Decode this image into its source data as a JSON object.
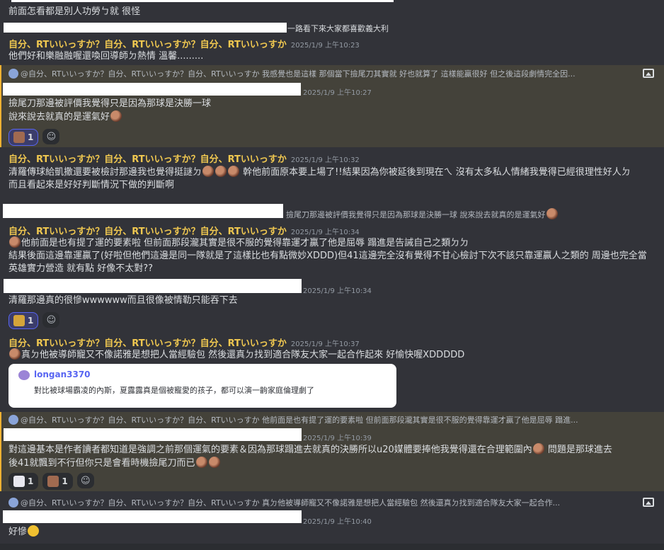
{
  "author": "自分、RTいいっすか？自分、RTいいっすか？自分、RTいいっすか",
  "top_text": "前面怎看都是別人功勞ㄅ就 很怪",
  "line2_suffix": "一路看下來大家都喜歡義大利",
  "messages": [
    {
      "ts": "2025/1/9 上午10:23",
      "text": "他們好和樂融融喔還喚回導師ㄉ熱情 溫馨........."
    },
    {
      "reply": "@自分、RTいいっすか？自分、RTいいっすか？自分、RTいいっすか 我感覺也是這樣 那個當下撿尾刀其實就 好也就算了 這樣能贏很好 但之後這段劇情完全因...",
      "ts": "2025/1/9 上午10:27",
      "text1": "撿尾刀那邊被評價我覺得只是因為那球是決勝一球",
      "text2": "說來說去就真的是運氣好",
      "reaction_count": "1"
    },
    {
      "ts": "2025/1/9 上午10:32",
      "text1": "清羅傳球給凱撒還要被檢討那邊我也覺得挺謎ㄉ",
      "text1b": " 幹他前面原本要上場了!!結果因為你被延後到現在ㄟ 沒有太多私人情緒我覺得已經很理性好人ㄉ",
      "text2": "而且看起來是好好判斷情況下做的判斷啊"
    },
    {
      "reply": "撿尾刀那邊被評價我覺得只是因為那球是決勝一球 說來說去就真的是運氣好",
      "ts": "2025/1/9 上午10:34",
      "text1": "他前面是也有提了運的要素啦 但前面那段瀧其實是很不服的覺得靠運才贏了他是屈辱 蹋進是告誡自己之類ㄉㄉ",
      "text2": "結果後面這邊靠運贏了(好啦但他們這邊是同一隊就是了這樣比也有點微妙XDDD)但41這邊完全沒有覺得不甘心檢討下次不該只靠運贏人之類的 周邊也完全當英雄實力營造 就有點 好像不太對??"
    },
    {
      "ts": "2025/1/9 上午10:34",
      "text": "清羅那邊真的很慘wwwwww而且很像被情勒只能吞下去",
      "reaction_count": "1"
    },
    {
      "ts": "2025/1/9 上午10:37",
      "text": "真ㄉ他被導師寵又不像諾雅是想把人當經驗包 然後還真ㄉ找到適合隊友大家一起合作起來 好愉快喔XDDDDD",
      "embed": {
        "name": "longan3370",
        "text": "對比被球場霸凌的內斯，夏露露真是個被寵愛的孩子，都可以演一齣家庭倫理劇了"
      }
    },
    {
      "reply": "@自分、RTいいっすか？自分、RTいいっすか？自分、RTいいっすか 他前面是也有提了運的要素啦 但前面那段瀧其實是很不服的覺得靠運才贏了他是屈辱 蹋進...",
      "ts": "2025/1/9 上午10:39",
      "text1": "對這邊基本是作者讀者都知道是強調之前那個運氣的要素＆因為那球蹋進去就真的決勝所以u20媒體要捧他我覺得還在合理範圍內",
      "text1b": " 問題是那球進去",
      "text2": "後41就飄到不行但你只是會看時機撿尾刀而已",
      "reaction_count_a": "1",
      "reaction_count_b": "1"
    },
    {
      "reply": "@自分、RTいいっすか？自分、RTいいっすか？自分、RTいいっすか 真ㄉ他被導師寵又不像諾雅是想把人當經驗包 然後還真ㄉ找到適合隊友大家一起合作...",
      "ts": "2025/1/9 上午10:40",
      "text": "好慘"
    }
  ],
  "colors": {
    "background": "#323339",
    "highlight": "#44423a",
    "author": "#f0c850",
    "accent": "#5865f2"
  }
}
